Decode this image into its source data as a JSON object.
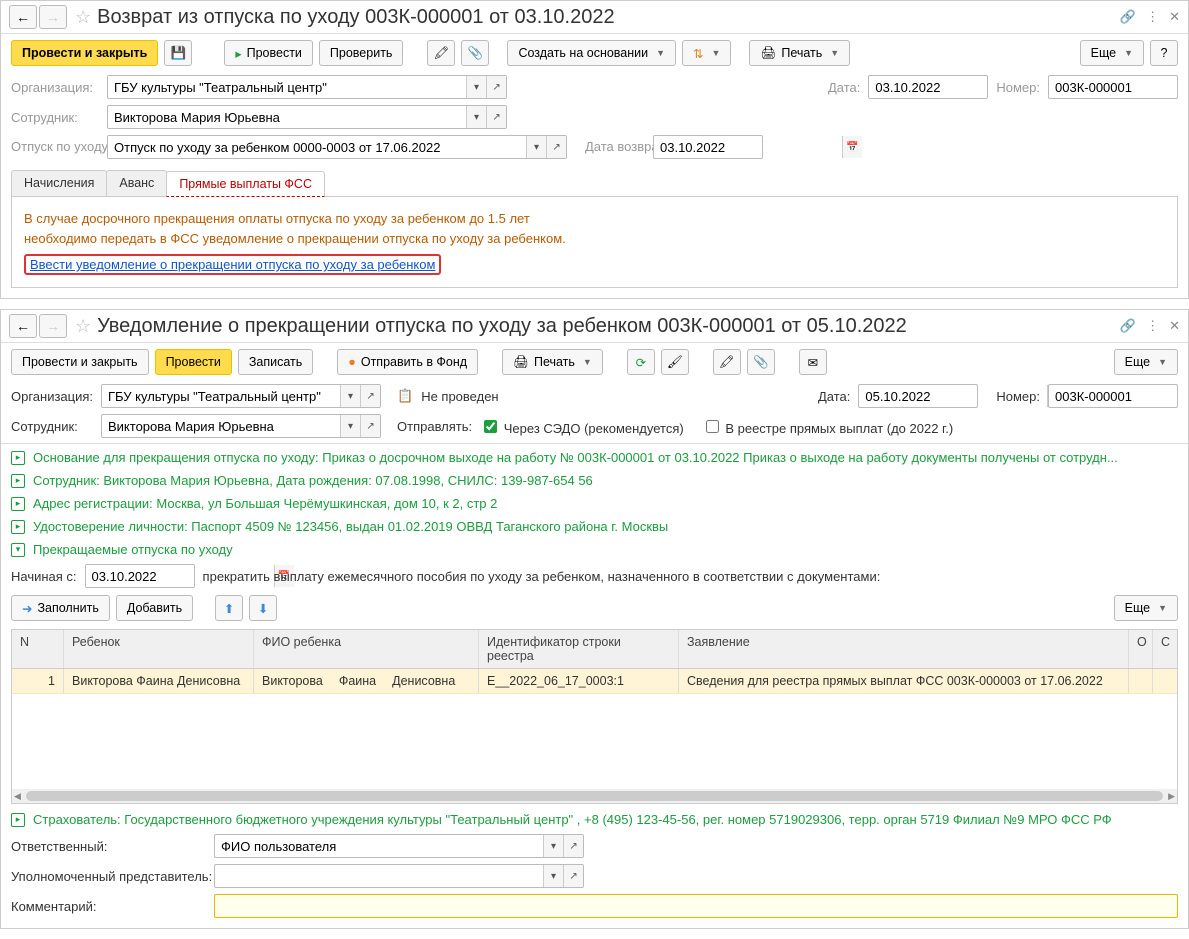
{
  "win1": {
    "title": "Возврат из отпуска по уходу 003К-000001 от 03.10.2022",
    "toolbar": {
      "post_close": "Провести и закрыть",
      "post": "Провести",
      "check": "Проверить",
      "create_based": "Создать на основании",
      "print": "Печать",
      "more": "Еще",
      "help": "?"
    },
    "fields": {
      "org_label": "Организация:",
      "org_value": "ГБУ культуры \"Театральный центр\"",
      "date_label": "Дата:",
      "date_value": "03.10.2022",
      "num_label": "Номер:",
      "num_value": "003К-000001",
      "emp_label": "Сотрудник:",
      "emp_value": "Викторова Мария Юрьевна",
      "leave_label": "Отпуск по уходу:",
      "leave_value": "Отпуск по уходу за ребенком 0000-0003 от 17.06.2022",
      "return_label": "Дата возврата:",
      "return_value": "03.10.2022"
    },
    "tabs": {
      "t1": "Начисления",
      "t2": "Аванс",
      "t3": "Прямые выплаты ФСС"
    },
    "fss": {
      "warn1": "В случае досрочного прекращения оплаты отпуска по уходу за ребенком до 1.5 лет",
      "warn2": "необходимо передать в ФСС уведомление о прекращении отпуска по уходу за ребенком.",
      "link": "Ввести уведомление о прекращении отпуска по уходу за ребенком"
    }
  },
  "win2": {
    "title": "Уведомление о прекращении отпуска по уходу за ребенком 003К-000001 от 05.10.2022",
    "toolbar": {
      "post_close": "Провести и закрыть",
      "post": "Провести",
      "write": "Записать",
      "send": "Отправить в Фонд",
      "print": "Печать",
      "more": "Еще"
    },
    "fields": {
      "org_label": "Организация:",
      "org_value": "ГБУ культуры \"Театральный центр\"",
      "status": "Не проведен",
      "date_label": "Дата:",
      "date_value": "05.10.2022",
      "num_label": "Номер:",
      "num_value": "003К-000001",
      "emp_label": "Сотрудник:",
      "emp_value": "Викторова Мария Юрьевна",
      "send_label": "Отправлять:",
      "send_opt1": "Через СЭДО (рекомендуется)",
      "send_opt2": "В реестре прямых выплат (до 2022 г.)"
    },
    "green": {
      "g1": "Основание для прекращения отпуска по уходу: Приказ о досрочном выходе на работу № 003К-000001 от 03.10.2022 Приказ о выходе на работу документы получены от сотрудн...",
      "g2": "Сотрудник: Викторова Мария Юрьевна, Дата рождения: 07.08.1998, СНИЛС: 139-987-654 56",
      "g3": "Адрес регистрации: Москва, ул Большая Черёмушкинская, дом 10, к 2, стр 2",
      "g4": "Удостоверение личности: Паспорт 4509 № 123456, выдан 01.02.2019 ОВВД Таганского района г. Москвы",
      "g5": "Прекращаемые отпуска по уходу",
      "g6": "Страхователь:  Государственного бюджетного учреждения культуры \"Театральный центр\" , +8 (495) 123-45-56, рег. номер 5719029306, терр. орган 5719 Филиал №9 МРО ФСС РФ"
    },
    "start_label": "Начиная с:",
    "start_value": "03.10.2022",
    "start_text": "прекратить выплату ежемесячного пособия по уходу за ребенком, назначенного в соответствии с документами:",
    "tbtb": {
      "fill": "Заполнить",
      "add": "Добавить",
      "more": "Еще"
    },
    "table": {
      "h_n": "N",
      "h_child": "Ребенок",
      "h_fio": "ФИО ребенка",
      "h_id": "Идентификатор строки реестра",
      "h_app": "Заявление",
      "h_o": "О",
      "h_c": "С",
      "r_n": "1",
      "r_child": "Викторова Фаина Денисовна",
      "r_fio1": "Викторова",
      "r_fio2": "Фаина",
      "r_fio3": "Денисовна",
      "r_id": "E__2022_06_17_0003:1",
      "r_app": "Сведения для реестра прямых выплат ФСС 003К-000003 от 17.06.2022"
    },
    "resp_label": "Ответственный:",
    "resp_value": "ФИО пользователя",
    "rep_label": "Уполномоченный представитель:",
    "comment_label": "Комментарий:"
  }
}
